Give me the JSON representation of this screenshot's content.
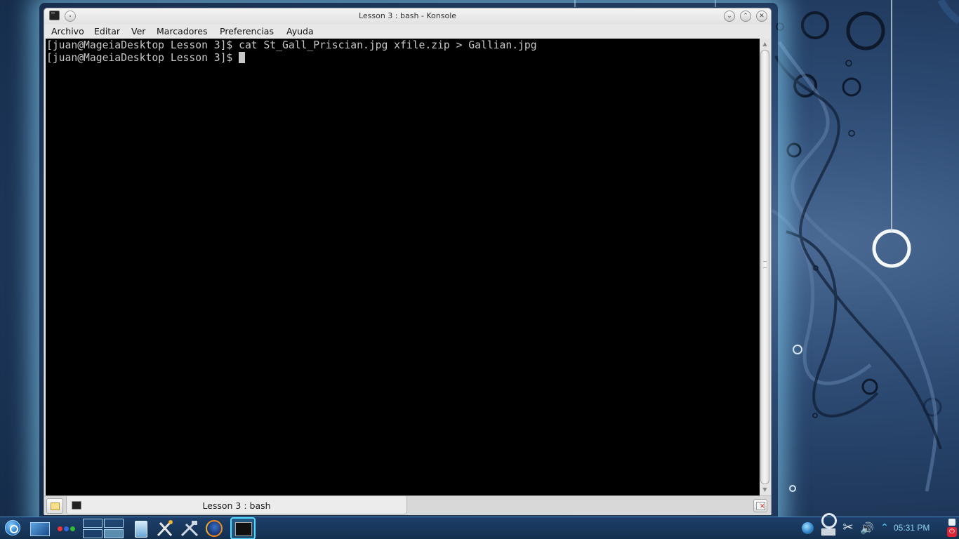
{
  "window": {
    "title": "Lesson 3 : bash - Konsole",
    "titlebar_buttons": [
      "minimize",
      "maximize",
      "close"
    ]
  },
  "menu": {
    "items": [
      "Archivo",
      "Editar",
      "Ver",
      "Marcadores",
      "Preferencias",
      "Ayuda"
    ]
  },
  "terminal": {
    "lines": [
      "[juan@MageiaDesktop Lesson 3]$ cat St_Gall_Priscian.jpg xfile.zip > Gallian.jpg",
      "[juan@MageiaDesktop Lesson 3]$ "
    ],
    "background": "#000000",
    "foreground": "#c8c8c8"
  },
  "tabs": [
    {
      "label": "Lesson 3 : bash",
      "active": true
    }
  ],
  "panel": {
    "clock": "05:31 PM",
    "accent": "#55d8ff",
    "icons": {
      "launcher": "kickoff-menu-icon",
      "show_desktop": "show-desktop-icon",
      "activities": "activities-icon",
      "pager": "virtual-desktop-pager",
      "tasks": [
        "file-manager-icon",
        "system-config-icon",
        "tools-icon",
        "firefox-icon",
        "konsole-icon"
      ],
      "tray": [
        "globe-icon",
        "network-icon",
        "clipboard-scissors-icon",
        "volume-icon",
        "expand-tray-icon",
        "cashew-icon"
      ]
    }
  }
}
